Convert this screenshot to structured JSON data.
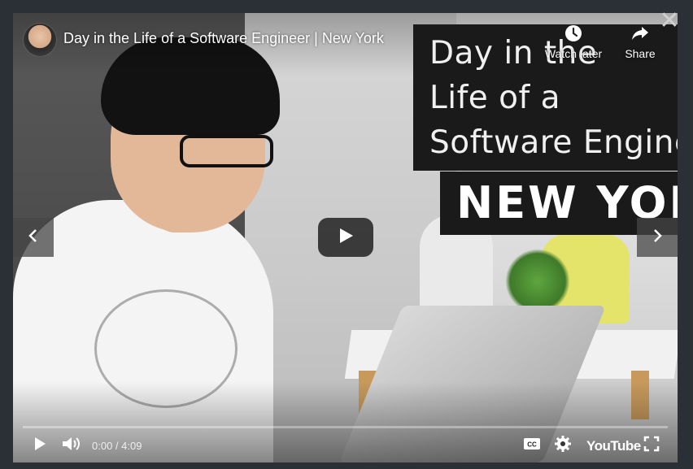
{
  "video": {
    "title": "Day in the Life of a Software Engineer | New York",
    "title_card_lines": [
      "Day in the",
      "Life of a",
      "Software Engineer"
    ],
    "title_card_banner": "NEW YORK",
    "progress_fraction": 0.0
  },
  "actions": {
    "watch_later": {
      "label": "Watch later",
      "icon": "clock-icon"
    },
    "share": {
      "label": "Share",
      "icon": "share-arrow-icon"
    }
  },
  "player": {
    "time_display": "0:00 / 4:09",
    "logo_text": "YouTube",
    "icons": {
      "close": "close-icon",
      "prev": "chevron-left-icon",
      "next": "chevron-right-icon",
      "play": "play-icon",
      "volume": "volume-icon",
      "captions": "cc-icon",
      "settings": "gear-icon",
      "fullscreen": "fullscreen-icon"
    }
  },
  "colors": {
    "backdrop": "#2b2f36",
    "progress_played": "#ff0000",
    "title_card_bg": "#1a1a1a"
  }
}
